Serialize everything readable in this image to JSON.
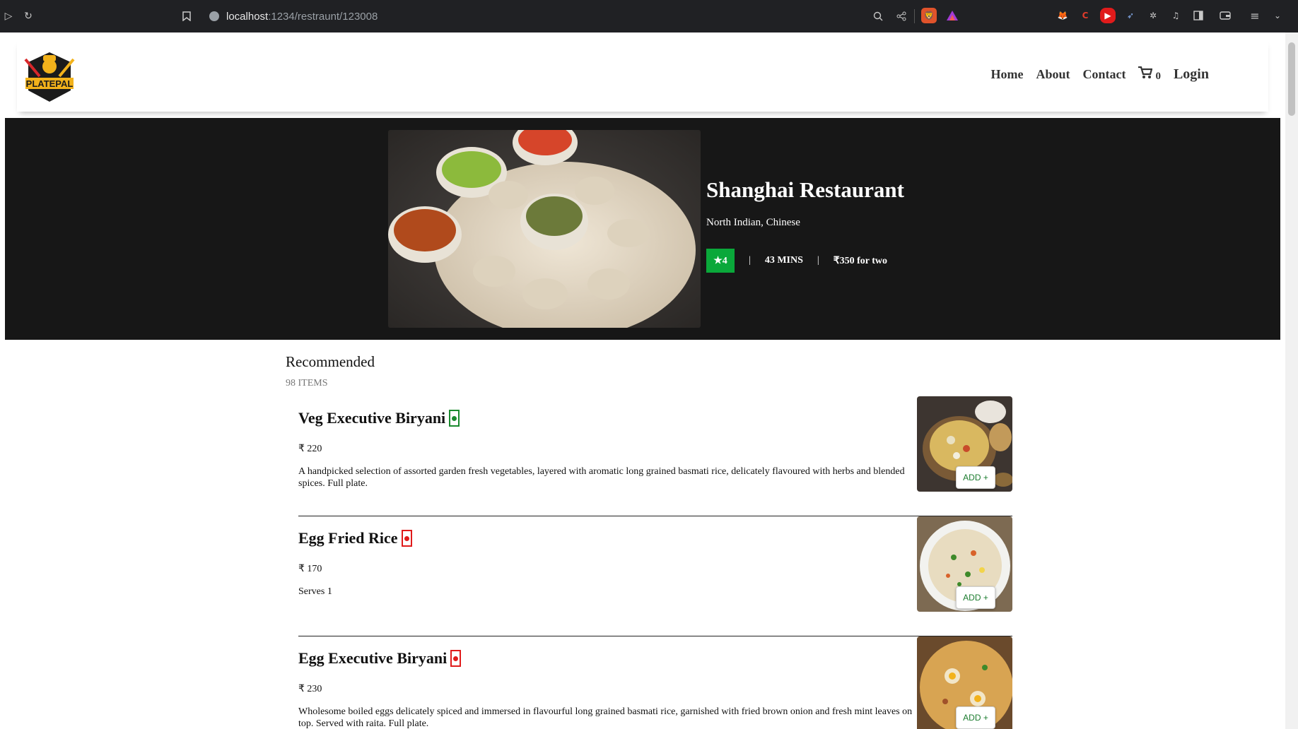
{
  "browser": {
    "url_host": "localhost",
    "url_path": ":1234/restraunt/123008",
    "icons": [
      "play-icon",
      "reload-icon",
      "bookmark-icon",
      "site-info-icon",
      "zoom-icon",
      "share-icon",
      "brave-icon",
      "rewards-icon",
      "metamask-icon",
      "extension-c-icon",
      "youtube-icon",
      "cursor-icon",
      "puzzle-icon",
      "music-icon",
      "sidebar-icon",
      "wallet-icon",
      "menu-icon",
      "chevron-down-icon"
    ]
  },
  "header": {
    "logo_text": "PLATEPAL",
    "nav": {
      "home": "Home",
      "about": "About",
      "contact": "Contact",
      "cart_count": "0",
      "login": "Login"
    }
  },
  "restaurant": {
    "name": "Shanghai Restaurant",
    "cuisines": "North Indian, Chinese",
    "rating": "★4",
    "delivery_time": "43 MINS",
    "cost_for_two": "₹350 for two",
    "separator": "|"
  },
  "menu": {
    "section_title": "Recommended",
    "item_count": "98 ITEMS",
    "add_label": "ADD +",
    "items": [
      {
        "name": "Veg Executive Biryani",
        "type": "veg",
        "price": "₹ 220",
        "description": "A handpicked selection of assorted garden fresh vegetables, layered with aromatic long grained basmati rice, delicately flavoured with herbs and blended spices. Full plate."
      },
      {
        "name": "Egg Fried Rice",
        "type": "nonveg",
        "price": "₹ 170",
        "description": "Serves 1"
      },
      {
        "name": "Egg Executive Biryani",
        "type": "nonveg",
        "price": "₹ 230",
        "description": "Wholesome boiled eggs delicately spiced and immersed in flavourful long grained basmati rice, garnished with fried brown onion and fresh mint leaves on top. Served with raita. Full plate."
      }
    ]
  },
  "colors": {
    "veg": "#1a8a2e",
    "nonveg": "#e01b1b",
    "rating_bg": "#0aa83a",
    "hero_bg": "#171717"
  }
}
